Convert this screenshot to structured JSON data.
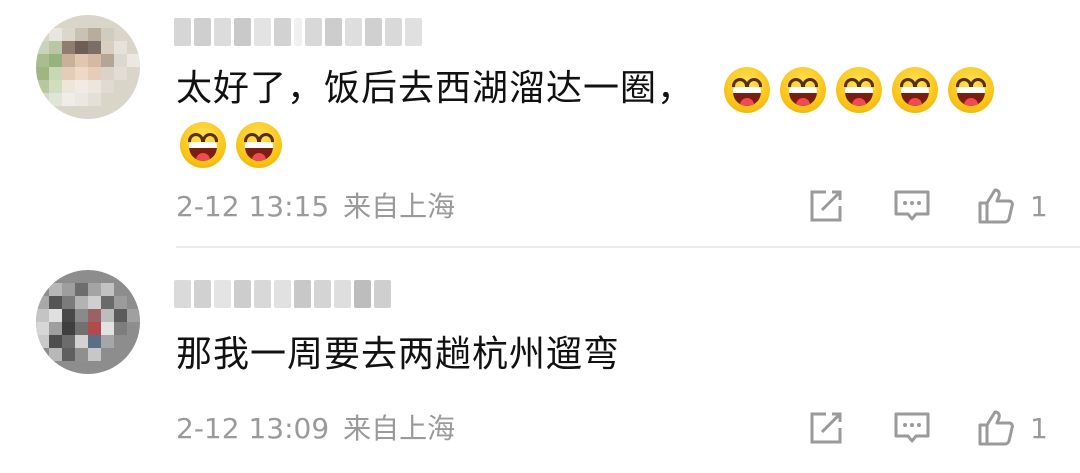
{
  "comments": [
    {
      "text": "太好了，饭后去西湖溜达一圈，",
      "emoji_count_line1": 5,
      "emoji_count_line2": 2,
      "emoji_icon": "laughing-emoji-icon",
      "time": "2-12 13:15",
      "location": "来自上海",
      "likes": "1"
    },
    {
      "text": "那我一周要去两趟杭州遛弯",
      "time": "2-12 13:09",
      "location": "来自上海",
      "likes": "1"
    }
  ],
  "colors": {
    "meta_gray": "#9a9a9a",
    "divider": "#ececec",
    "emoji_yellow": "#f8c315"
  }
}
